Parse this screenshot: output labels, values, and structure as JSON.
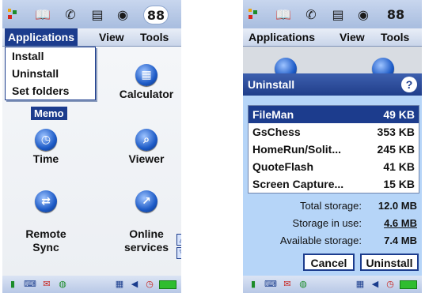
{
  "left": {
    "menubar": {
      "applications": "Applications",
      "view": "View",
      "tools": "Tools"
    },
    "dropdown": [
      "Install",
      "Uninstall",
      "Set folders"
    ],
    "apps": [
      {
        "label": "Calculator",
        "icon": "calculator-icon",
        "glyph": "▦"
      },
      {
        "label": "Time",
        "icon": "clock-icon",
        "glyph": "◷"
      },
      {
        "label": "Viewer",
        "icon": "viewer-icon",
        "glyph": "⌕"
      },
      {
        "label": "Remote\nSync",
        "icon": "remote-sync-icon",
        "glyph": "⇄"
      },
      {
        "label": "Online\nservices",
        "icon": "online-services-icon",
        "glyph": "↗"
      }
    ],
    "memo_label": "Memo"
  },
  "right": {
    "menubar": {
      "applications": "Applications",
      "view": "View",
      "tools": "Tools"
    },
    "dialog": {
      "title": "Uninstall",
      "items": [
        {
          "name": "FileMan",
          "size": "49 KB",
          "selected": true
        },
        {
          "name": "GsChess",
          "size": "353 KB",
          "selected": false
        },
        {
          "name": "HomeRun/Solit...",
          "size": "245 KB",
          "selected": false
        },
        {
          "name": "QuoteFlash",
          "size": "41 KB",
          "selected": false
        },
        {
          "name": "Screen Capture...",
          "size": "15 KB",
          "selected": false
        }
      ],
      "total_label": "Total storage:",
      "total_value": "12.0 MB",
      "in_use_label": "Storage in use:",
      "in_use_value": "4.6 MB",
      "available_label": "Available storage:",
      "available_value": "7.4 MB",
      "cancel_label": "Cancel",
      "uninstall_label": "Uninstall"
    }
  },
  "colors": {
    "accent": "#1c3c8d",
    "dialog_bg": "#b6d5f8",
    "bar_bg": "#a8bddf"
  }
}
